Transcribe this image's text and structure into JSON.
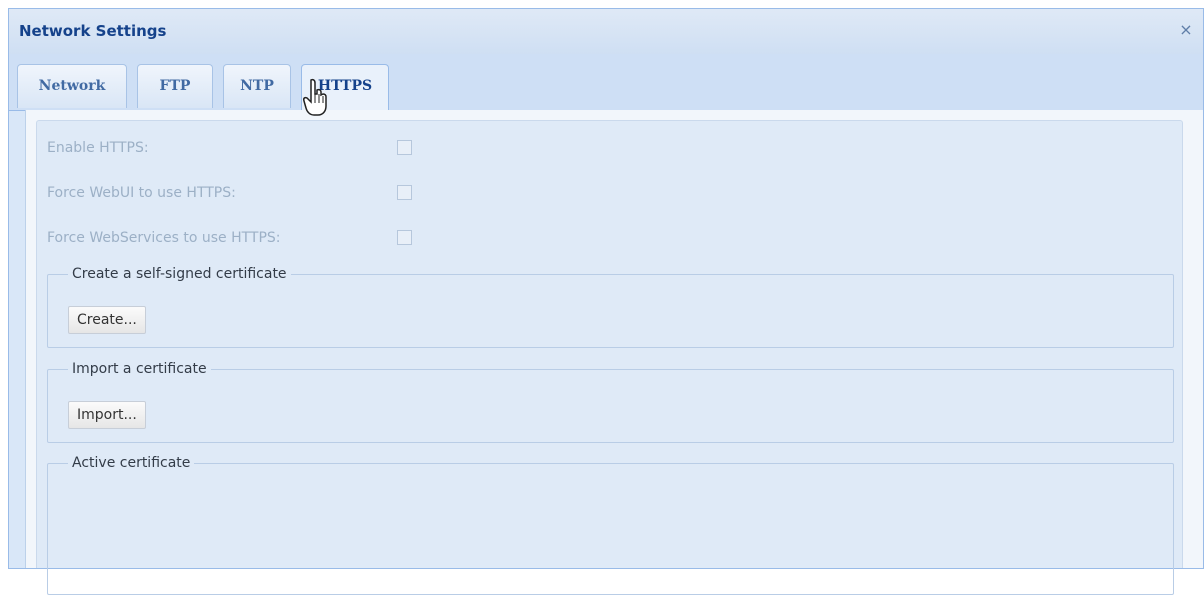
{
  "window": {
    "title": "Network Settings",
    "close_glyph": "×"
  },
  "tabs": [
    {
      "label": "Network",
      "active": false
    },
    {
      "label": "FTP",
      "active": false
    },
    {
      "label": "NTP",
      "active": false
    },
    {
      "label": "HTTPS",
      "active": true
    }
  ],
  "https": {
    "enable_label": "Enable HTTPS:",
    "force_webui_label": "Force WebUI to use HTTPS:",
    "force_webservices_label": "Force WebServices to use HTTPS:",
    "self_signed": {
      "legend": "Create a self-signed certificate",
      "button": "Create..."
    },
    "import": {
      "legend": "Import a certificate",
      "button": "Import..."
    },
    "active": {
      "legend": "Active certificate"
    }
  },
  "icons": {
    "close": "close-icon",
    "cursor": "hand-pointer-cursor-icon"
  }
}
